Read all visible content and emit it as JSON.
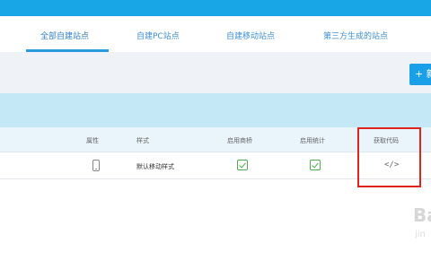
{
  "tabs": [
    {
      "label": "全部自建站点",
      "active": true
    },
    {
      "label": "自建PC站点",
      "active": false
    },
    {
      "label": "自建移动站点",
      "active": false
    },
    {
      "label": "第三方生成的站点",
      "active": false
    }
  ],
  "toolbar": {
    "add_label": "+ 新"
  },
  "table": {
    "headers": [
      "属性",
      "样式",
      "启用商桥",
      "启用统计",
      "获取代码"
    ],
    "rows": [
      {
        "type_icon": "phone-icon",
        "style": "默认移动样式",
        "bridge_enabled": true,
        "stats_enabled": true,
        "code_icon": "</>"
      }
    ]
  },
  "watermark": {
    "main": "Ba",
    "sub": "jin"
  },
  "colors": {
    "topbar": "#19a6e6",
    "accent": "#2b9be0",
    "highlight": "#e2231a",
    "check": "#4cae4c"
  }
}
